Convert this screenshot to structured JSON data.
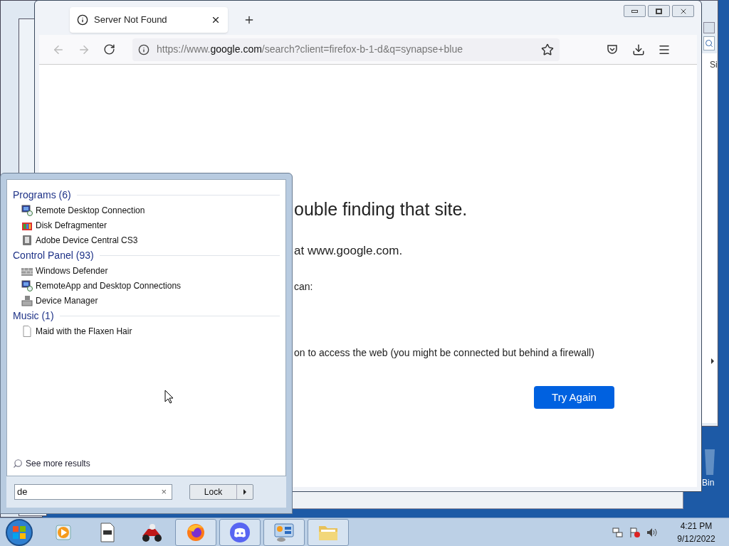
{
  "background_window": {
    "text": "Si"
  },
  "desktop_icon": {
    "label": "Bin"
  },
  "browser": {
    "tab": {
      "title": "Server Not Found",
      "selected": true
    },
    "url": {
      "prefix": "https://www.",
      "domain": "google.com",
      "rest": "/search?client=firefox-b-1-d&q=synapse+blue"
    },
    "page": {
      "heading": "ouble finding that site.",
      "lines": [
        {
          "kind": "lead",
          "text": "at www.google.com."
        },
        {
          "kind": "body",
          "text": "can:"
        },
        {
          "kind": "body",
          "text": "on to access the web (you might be connected but behind a firewall)"
        }
      ],
      "button": "Try Again"
    }
  },
  "start_menu": {
    "groups": [
      {
        "title": "Programs (6)",
        "items": [
          {
            "label": "Remote Desktop Connection",
            "kind": "remote"
          },
          {
            "label": "Disk Defragmenter",
            "kind": "defrag"
          },
          {
            "label": "Adobe Device Central CS3",
            "kind": "device"
          }
        ]
      },
      {
        "title": "Control Panel (93)",
        "items": [
          {
            "label": "Windows Defender",
            "kind": "defender"
          },
          {
            "label": "RemoteApp and Desktop Connections",
            "kind": "remote"
          },
          {
            "label": "Device Manager",
            "kind": "manager"
          }
        ]
      },
      {
        "title": "Music (1)",
        "items": [
          {
            "label": "Maid with the Flaxen Hair",
            "kind": "file"
          }
        ]
      }
    ],
    "see_more": "See more results",
    "search": {
      "value": "de",
      "clear": "×"
    },
    "power_button": "Lock"
  },
  "taskbar": {
    "apps": [
      {
        "kind": "media",
        "active": false
      },
      {
        "kind": "document",
        "active": false
      },
      {
        "kind": "game",
        "active": false
      },
      {
        "kind": "firefox",
        "active": true
      },
      {
        "kind": "chat",
        "active": true
      },
      {
        "kind": "control",
        "active": true
      },
      {
        "kind": "folder",
        "active": true
      }
    ],
    "clock": {
      "time": "4:21 PM",
      "date": "9/12/2022"
    }
  }
}
